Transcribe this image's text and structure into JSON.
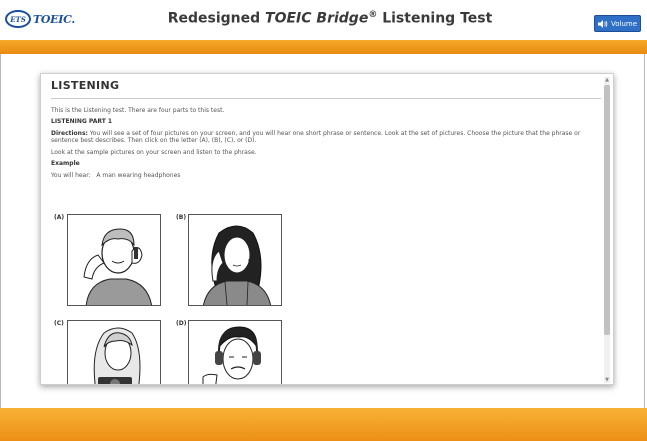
{
  "header": {
    "logo_ets": "ETS",
    "logo_toeic": "TOEIC.",
    "title_prefix": "Redesigned ",
    "title_product": "TOEIC Bridge",
    "title_reg": "®",
    "title_suffix": " Listening Test",
    "volume_label": "Volume"
  },
  "panel": {
    "heading": "LISTENING",
    "intro": "This is the Listening test. There are four parts to this test.",
    "part_heading": "LISTENING PART 1",
    "directions_label": "Directions:",
    "directions_text": " You will see a set of four pictures on your screen, and you will hear one short phrase or sentence. Look at the set of pictures. Choose the picture that the phrase or sentence best describes. Then click on the letter (A), (B), (C), or (D).",
    "look_text": "Look at the sample pictures on your screen and listen to the phrase.",
    "example_heading": "Example",
    "you_will_hear_label": "You will hear:",
    "you_will_hear_text": "A man wearing headphones",
    "pictures": [
      {
        "label": "(A)",
        "description": "man on phone"
      },
      {
        "label": "(B)",
        "description": "woman with earbuds"
      },
      {
        "label": "(C)",
        "description": "woman with camera"
      },
      {
        "label": "(D)",
        "description": "man with headphones"
      }
    ]
  },
  "colors": {
    "orange_band": "#ec8f16",
    "volume_button": "#2f6fc6",
    "logo_blue": "#1b4fa0"
  }
}
